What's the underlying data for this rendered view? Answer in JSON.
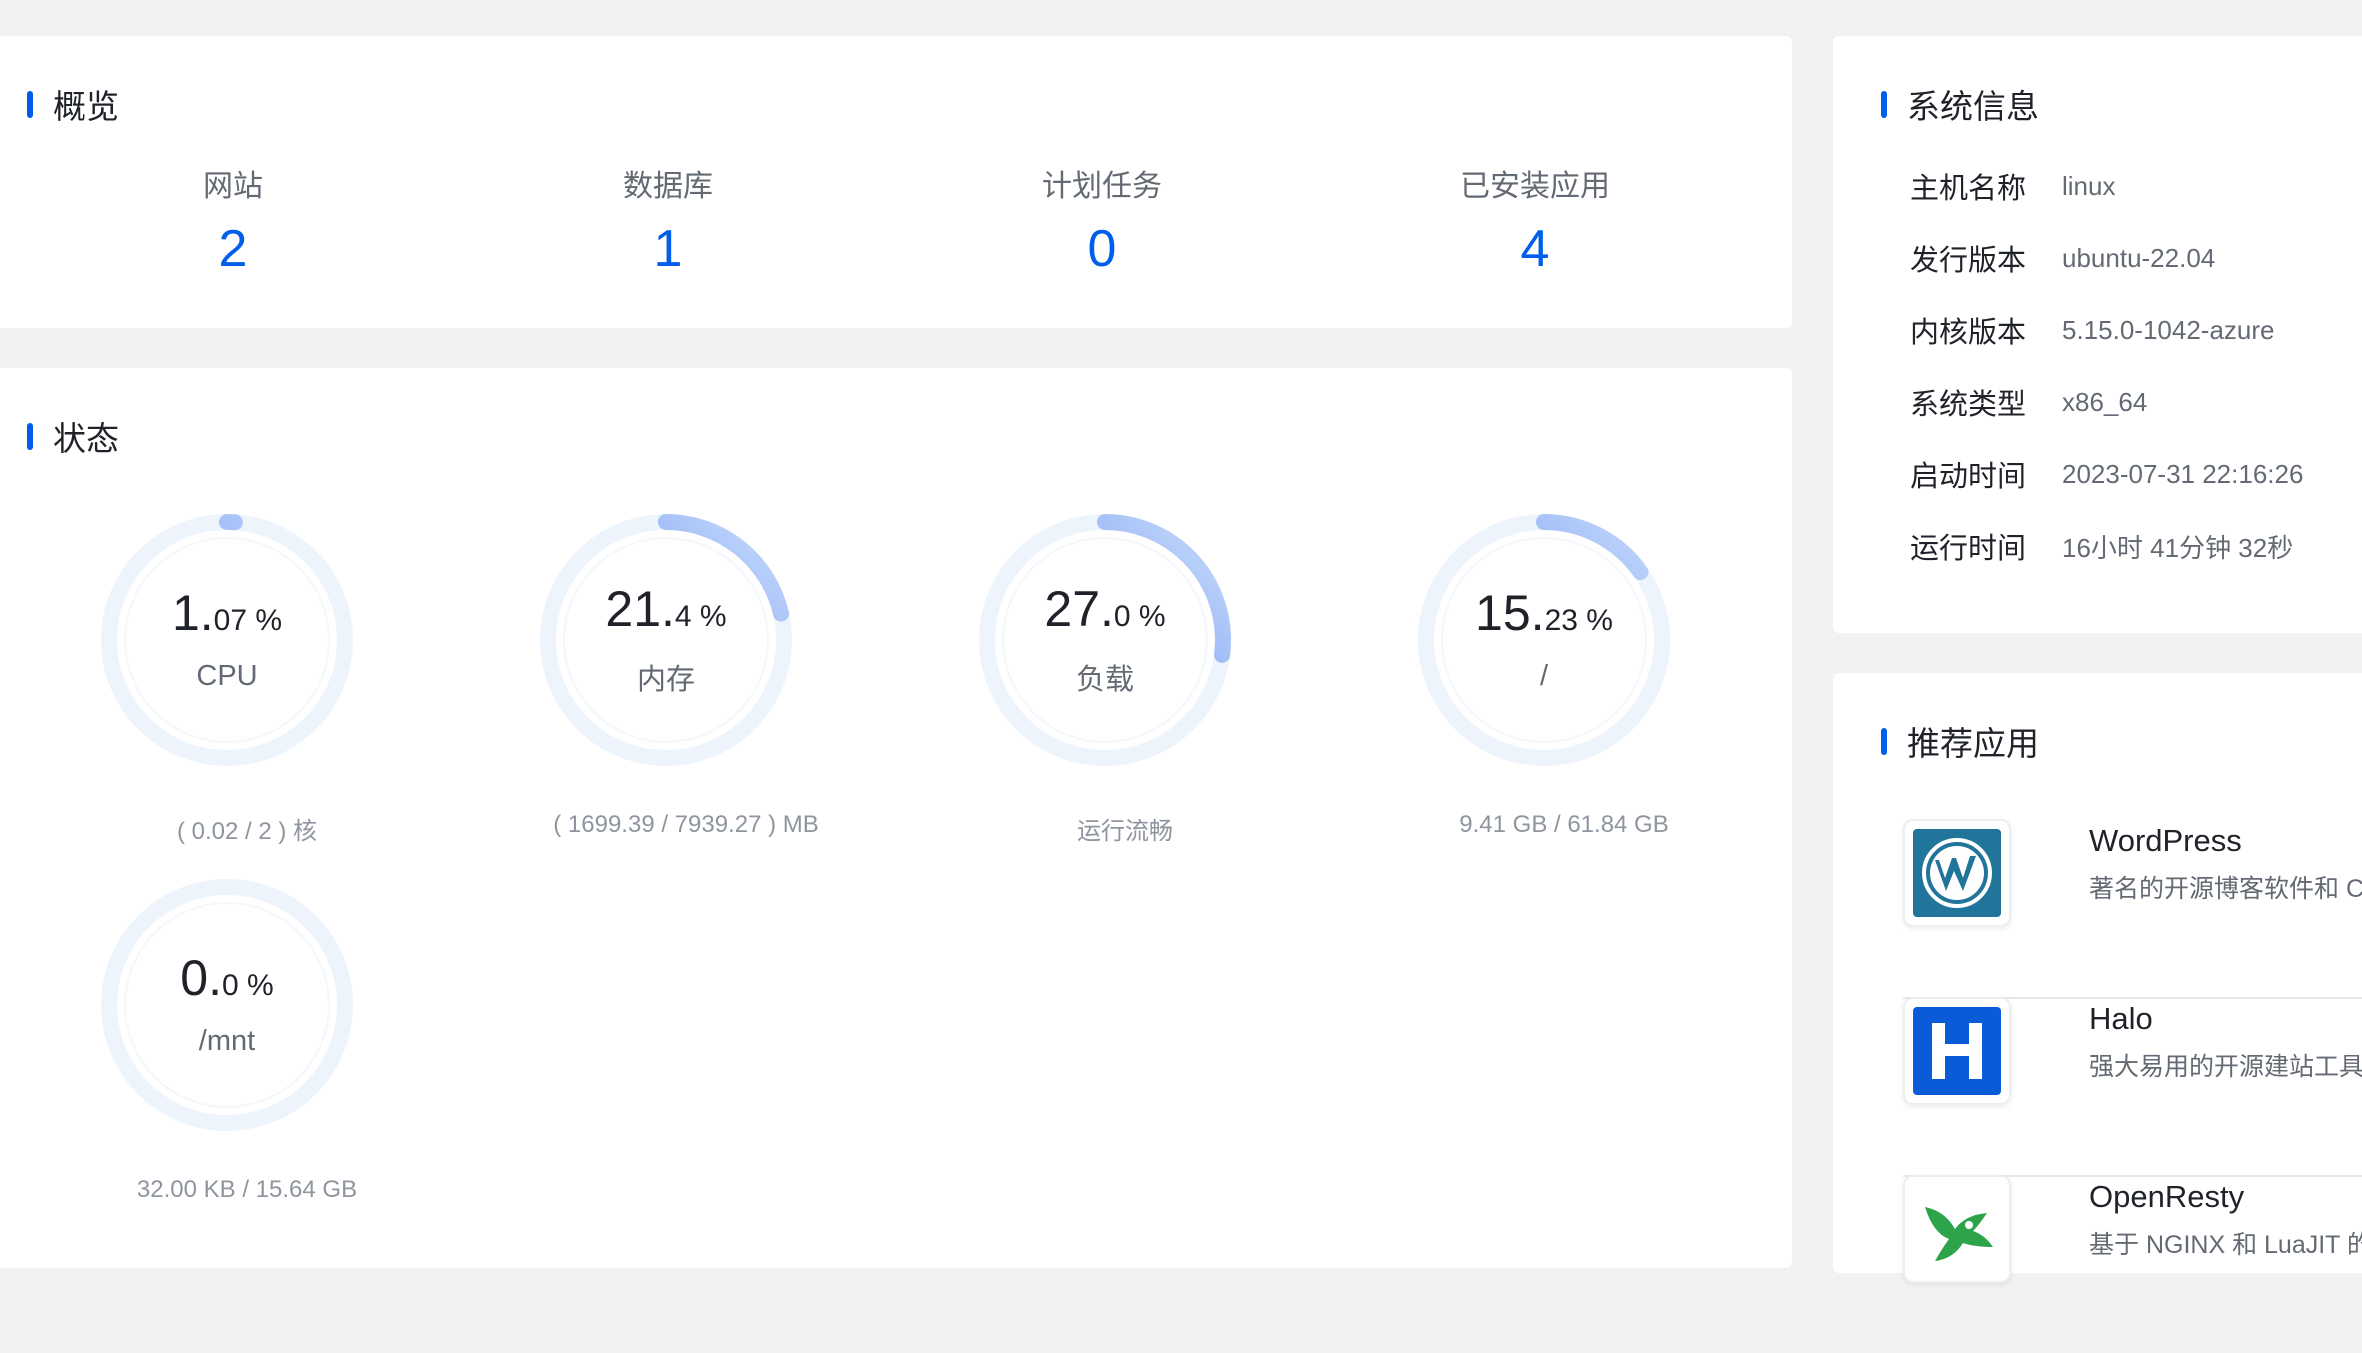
{
  "overview": {
    "title": "概览",
    "items": [
      {
        "label": "网站",
        "value": "2"
      },
      {
        "label": "数据库",
        "value": "1"
      },
      {
        "label": "计划任务",
        "value": "0"
      },
      {
        "label": "已安装应用",
        "value": "4"
      }
    ]
  },
  "status": {
    "title": "状态",
    "gauges": [
      {
        "int": "1.",
        "frac": "07 %",
        "name": "CPU",
        "desc": "( 0.02 / 2 ) 核",
        "percent": 1.07
      },
      {
        "int": "21.",
        "frac": "4 %",
        "name": "内存",
        "desc": "( 1699.39 / 7939.27 ) MB",
        "percent": 21.4
      },
      {
        "int": "27.",
        "frac": "0 %",
        "name": "负载",
        "desc": "运行流畅",
        "percent": 27.0
      },
      {
        "int": "15.",
        "frac": "23 %",
        "name": "/",
        "desc": "9.41 GB / 61.84 GB",
        "percent": 15.23
      },
      {
        "int": "0.",
        "frac": "0 %",
        "name": "/mnt",
        "desc": "32.00 KB / 15.64 GB",
        "percent": 0.0
      }
    ]
  },
  "system_info": {
    "title": "系统信息",
    "rows": [
      {
        "label": "主机名称",
        "value": "linux"
      },
      {
        "label": "发行版本",
        "value": "ubuntu-22.04"
      },
      {
        "label": "内核版本",
        "value": "5.15.0-1042-azure"
      },
      {
        "label": "系统类型",
        "value": "x86_64"
      },
      {
        "label": "启动时间",
        "value": "2023-07-31 22:16:26"
      },
      {
        "label": "运行时间",
        "value": "16小时 41分钟 32秒"
      }
    ]
  },
  "recommended": {
    "title": "推荐应用",
    "apps": [
      {
        "name": "WordPress",
        "desc": "著名的开源博客软件和 CMS",
        "icon": "wordpress-icon"
      },
      {
        "name": "Halo",
        "desc": "强大易用的开源建站工具",
        "icon": "halo-icon"
      },
      {
        "name": "OpenResty",
        "desc": "基于 NGINX 和 LuaJIT 的",
        "icon": "openresty-icon"
      }
    ]
  },
  "colors": {
    "accent": "#005eeb",
    "gauge_track": "#eef4fc",
    "gauge_arc_start": "#4e6ef2",
    "gauge_arc_end": "#c7defa",
    "page_bg": "#f2f2f2"
  }
}
